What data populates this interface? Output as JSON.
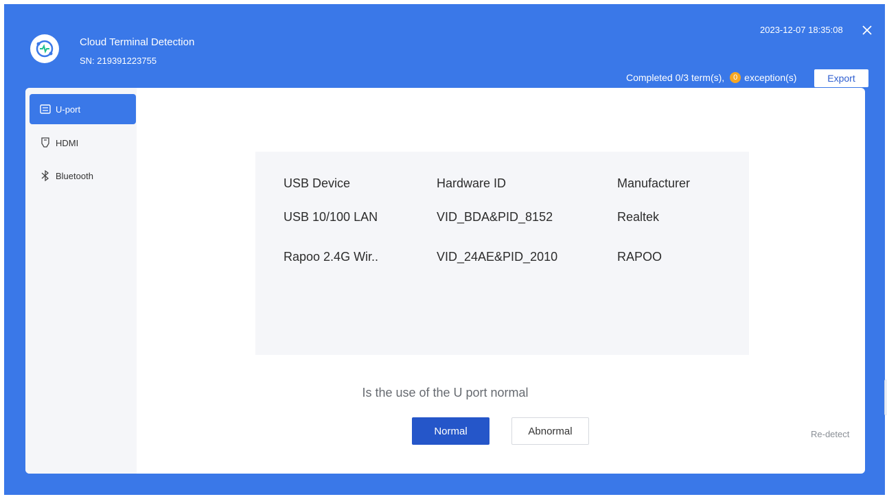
{
  "header": {
    "app_title": "Cloud Terminal Detection",
    "serial": "SN: 219391223755",
    "datetime": "2023-12-07 18:35:08",
    "status_text": "Completed 0/3 term(s),",
    "exception_count": "0",
    "exception_label": "exception(s)",
    "export_label": "Export",
    "logo_icon": "pulse-monitor-icon",
    "close_icon": "close-icon"
  },
  "sidebar": {
    "items": [
      {
        "label": "U-port",
        "icon": "usb-port-icon",
        "active": true
      },
      {
        "label": "HDMI",
        "icon": "hdmi-icon",
        "active": false
      },
      {
        "label": "Bluetooth",
        "icon": "bluetooth-icon",
        "active": false
      }
    ]
  },
  "devices": {
    "headers": [
      "USB Device",
      "Hardware ID",
      "Manufacturer"
    ],
    "rows": [
      [
        "USB 10/100 LAN",
        "VID_BDA&PID_8152",
        "Realtek"
      ],
      [
        "Rapoo 2.4G Wir..",
        "VID_24AE&PID_2010",
        "RAPOO"
      ]
    ]
  },
  "question": {
    "text": "Is the use of the U port normal",
    "normal_label": "Normal",
    "abnormal_label": "Abnormal"
  },
  "redetect_label": "Re-detect",
  "colors": {
    "accent": "#3A78E8",
    "primary_button": "#2556C9",
    "warning": "#F5A623",
    "panel_gray": "#F5F6F9"
  }
}
